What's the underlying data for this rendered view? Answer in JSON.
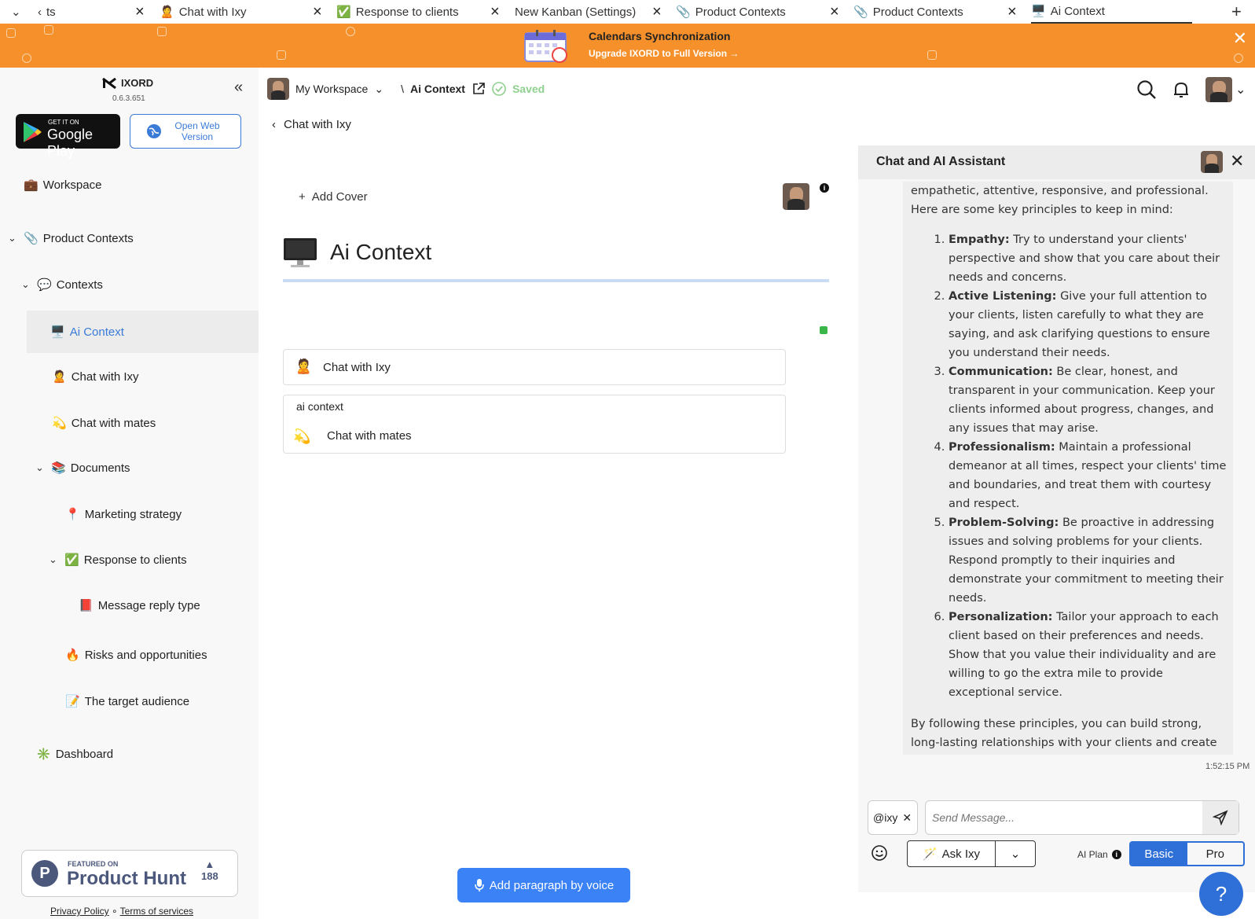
{
  "tabs": [
    {
      "label": "ts",
      "active": false
    },
    {
      "label": "Chat with Ixy",
      "icon": "🙎",
      "active": false
    },
    {
      "label": "Response to clients",
      "icon": "✅",
      "active": false
    },
    {
      "label": "New Kanban (Settings)",
      "icon": "",
      "active": false
    },
    {
      "label": "Product Contexts",
      "icon": "📎",
      "active": false
    },
    {
      "label": "Product Contexts",
      "icon": "📎",
      "active": false
    },
    {
      "label": "Ai Context",
      "icon": "🖥️",
      "active": true
    }
  ],
  "banner": {
    "title": "Calendars Synchronization",
    "subtitle": "Upgrade IXORD to Full Version"
  },
  "sidebar": {
    "app_name": "IXORD",
    "version": "0.6.3.651",
    "google_play_small": "GET IT ON",
    "google_play_large": "Google Play",
    "web_version": "Open Web Version",
    "workspace": "Workspace",
    "items": [
      {
        "label": "Product Contexts",
        "icon": "📎"
      },
      {
        "label": "Contexts",
        "icon": "💬"
      },
      {
        "label": "Ai Context",
        "icon": "🖥️"
      },
      {
        "label": "Chat with Ixy",
        "icon": "🙎"
      },
      {
        "label": "Chat with mates",
        "icon": "💫"
      },
      {
        "label": "Documents",
        "icon": "📚"
      },
      {
        "label": "Marketing strategy",
        "icon": "📍"
      },
      {
        "label": "Response to clients",
        "icon": "✅"
      },
      {
        "label": "Message reply type",
        "icon": "📕"
      },
      {
        "label": "Risks and opportunities",
        "icon": "🔥"
      },
      {
        "label": "The target audience",
        "icon": "📝"
      },
      {
        "label": "Dashboard",
        "icon": "✳️"
      }
    ],
    "product_hunt": {
      "featured": "FEATURED ON",
      "name": "Product Hunt",
      "votes": "188"
    },
    "privacy": "Privacy Policy",
    "terms": "Terms of services"
  },
  "header": {
    "workspace": "My Workspace",
    "separator": "\\",
    "page": "Ai Context",
    "saved": "Saved"
  },
  "main": {
    "back_label": "Chat with Ixy",
    "add_cover": "Add Cover",
    "title": "Ai Context",
    "card1": "Chat with Ixy",
    "card2_caption": "ai context",
    "card2_label": "Chat with mates",
    "voice_button": "Add paragraph by voice"
  },
  "chat": {
    "title": "Chat and AI Assistant",
    "intro": "empathetic, attentive, responsive, and professional. Here are some key principles to keep in mind:",
    "principles": [
      {
        "head": "Empathy:",
        "text": "Try to understand your clients' perspective and show that you care about their needs and concerns."
      },
      {
        "head": "Active Listening:",
        "text": "Give your full attention to your clients, listen carefully to what they are saying, and ask clarifying questions to ensure you understand their needs."
      },
      {
        "head": "Communication:",
        "text": "Be clear, honest, and transparent in your communication. Keep your clients informed about progress, changes, and any issues that may arise."
      },
      {
        "head": "Professionalism:",
        "text": "Maintain a professional demeanor at all times, respect your clients' time and boundaries, and treat them with courtesy and respect."
      },
      {
        "head": "Problem-Solving:",
        "text": "Be proactive in addressing issues and solving problems for your clients. Respond promptly to their inquiries and demonstrate your commitment to meeting their needs."
      },
      {
        "head": "Personalization:",
        "text": "Tailor your approach to each client based on their preferences and needs. Show that you value their individuality and are willing to go the extra mile to provide exceptional service."
      }
    ],
    "outro": "By following these principles, you can build strong, long-lasting relationships with your clients and create a positive and memorable experience for them.",
    "time": "1:52:15 PM",
    "tag": "@ixy",
    "placeholder": "Send Message...",
    "ask": "Ask Ixy",
    "plan_label": "AI Plan",
    "plan_basic": "Basic",
    "plan_pro": "Pro"
  },
  "colors": {
    "banner": "#f5902a",
    "accent": "#2f6fd8",
    "saved": "#8fd08f"
  }
}
